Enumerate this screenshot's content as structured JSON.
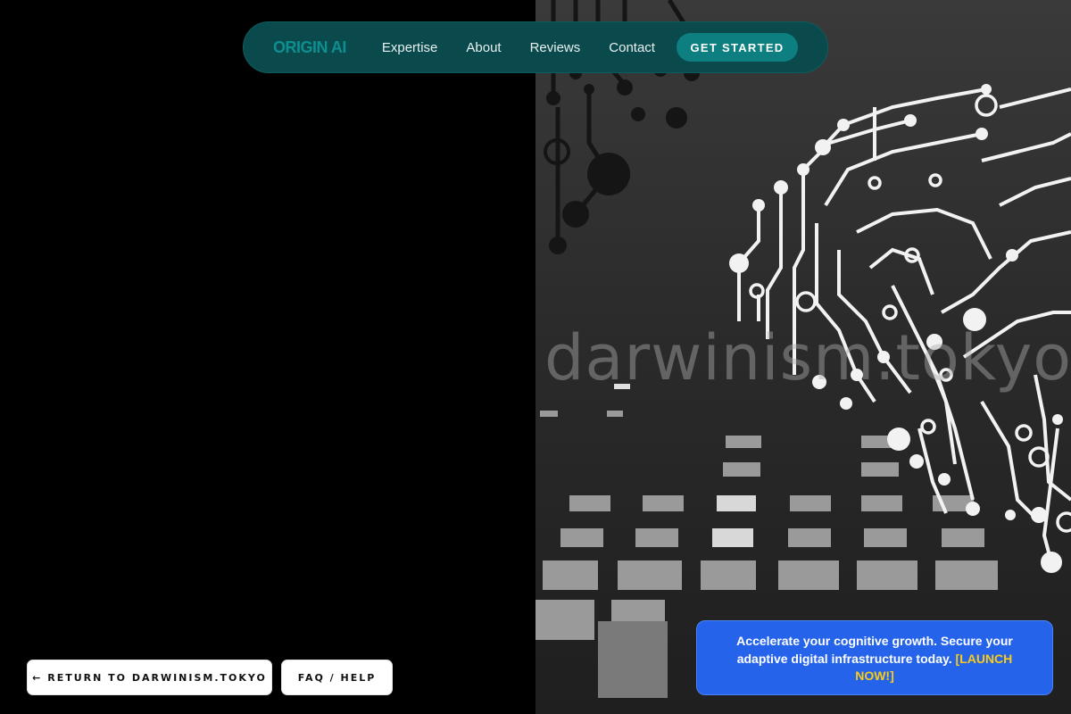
{
  "nav": {
    "brand": "ORIGIN AI",
    "links": [
      "Expertise",
      "About",
      "Reviews",
      "Contact"
    ],
    "cta": "GET STARTED"
  },
  "hero_art": {
    "text": "darwinism.tokyo",
    "icon": "circuit-brain-icon"
  },
  "footer_buttons": {
    "return": "← RETURN TO DARWINISM.TOKYO",
    "faq": "FAQ / HELP"
  },
  "promo": {
    "text": "Accelerate your cognitive growth. Secure your adaptive digital infrastructure today.",
    "cta": "[LAUNCH NOW!]"
  },
  "colors": {
    "nav_bg": "#0a4a4c",
    "brand": "#0e8f8f",
    "cta_bg": "#0d7f80",
    "promo_bg": "#2563eb",
    "promo_cta": "#facc15"
  }
}
